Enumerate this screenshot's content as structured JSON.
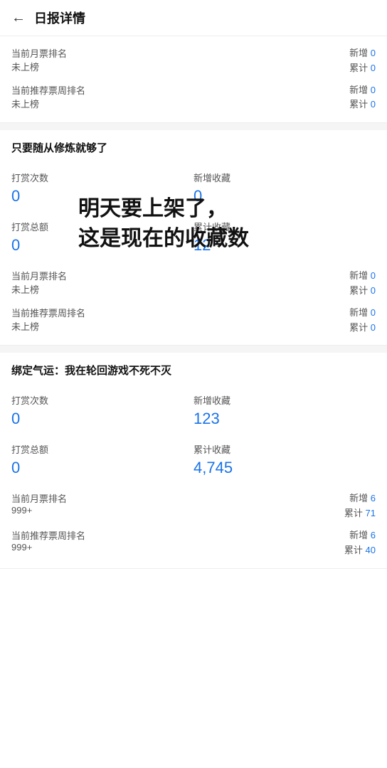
{
  "header": {
    "title": "日报详情",
    "back_icon": "‹"
  },
  "section1": {
    "row1": {
      "label": "当前月票排名",
      "sub_label": "未上榜",
      "new_label": "新增",
      "new_value": "0",
      "total_label": "累计",
      "total_value": "0"
    },
    "row2": {
      "label": "当前推荐票周排名",
      "sub_label": "未上榜",
      "new_label": "新增",
      "new_value": "0",
      "total_label": "累计",
      "total_value": "0"
    }
  },
  "section2": {
    "title": "只要随从修炼就够了",
    "reward_count_label": "打赏次数",
    "reward_count_value": "0",
    "new_collect_label": "新增收藏",
    "new_collect_value": "0",
    "reward_total_label": "打赏总额",
    "reward_total_value": "0",
    "total_collect_label": "累计收藏",
    "total_collect_value": "12",
    "rank_rows": [
      {
        "label": "当前月票排名",
        "sub": "未上榜",
        "new_label": "新增",
        "new_value": "0",
        "total_label": "累计",
        "total_value": "0"
      },
      {
        "label": "当前推荐票周排名",
        "sub": "未上榜",
        "new_label": "新增",
        "new_value": "0",
        "total_label": "累计",
        "total_value": "0"
      }
    ]
  },
  "section3": {
    "title": "绑定气运：我在轮回游戏不死不灭",
    "reward_count_label": "打赏次数",
    "reward_count_value": "0",
    "new_collect_label": "新增收藏",
    "new_collect_value": "123",
    "reward_total_label": "打赏总额",
    "reward_total_value": "0",
    "total_collect_label": "累计收藏",
    "total_collect_value": "4,745",
    "rank_rows": [
      {
        "label": "当前月票排名",
        "sub": "999+",
        "new_label": "新增",
        "new_value": "6",
        "total_label": "累计",
        "total_value": "71"
      },
      {
        "label": "当前推荐票周排名",
        "sub": "999+",
        "new_label": "新增",
        "new_value": "6",
        "total_label": "累计",
        "total_value": "40"
      }
    ]
  },
  "overlay": {
    "line1": "明天要上架了，",
    "line2": "这是现在的收藏数"
  }
}
